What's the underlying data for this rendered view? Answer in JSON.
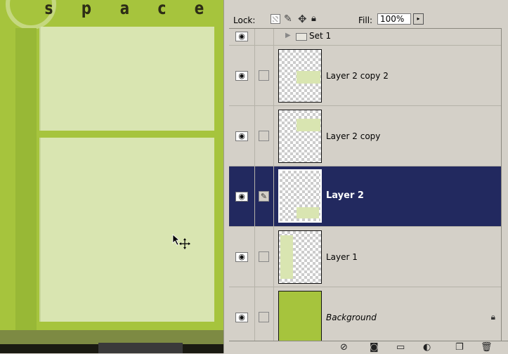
{
  "canvas": {
    "word_letters": [
      "s",
      "p",
      "a",
      "c",
      "e"
    ]
  },
  "options": {
    "lock_label": "Lock:",
    "fill_label": "Fill:",
    "fill_value": "100%",
    "fill_arrow": "▸",
    "lock_icons": [
      "lock-transparent-icon",
      "lock-image-brush-icon",
      "lock-position-move-icon",
      "lock-all-icon"
    ]
  },
  "layers": {
    "set": {
      "name": "Set 1",
      "expanded": false
    },
    "rows": [
      {
        "name": "Layer 2 copy 2",
        "selected": false,
        "linked": false
      },
      {
        "name": "Layer 2 copy",
        "selected": false,
        "linked": false
      },
      {
        "name": "Layer 2",
        "selected": true,
        "linked": true
      },
      {
        "name": "Layer 1",
        "selected": false,
        "linked": false
      },
      {
        "name": "Background",
        "selected": false,
        "linked": false,
        "locked": true
      }
    ]
  },
  "footer": {
    "buttons": [
      "layer-style-icon",
      "add-mask-icon",
      "new-set-icon",
      "adjustment-layer-icon",
      "new-layer-icon",
      "trash-icon"
    ]
  },
  "colors": {
    "canvas_green": "#a6c43d",
    "panel_light_green": "#d9e5b1",
    "selected_row": "#22295f",
    "panel_gray": "#d4d0c8"
  }
}
